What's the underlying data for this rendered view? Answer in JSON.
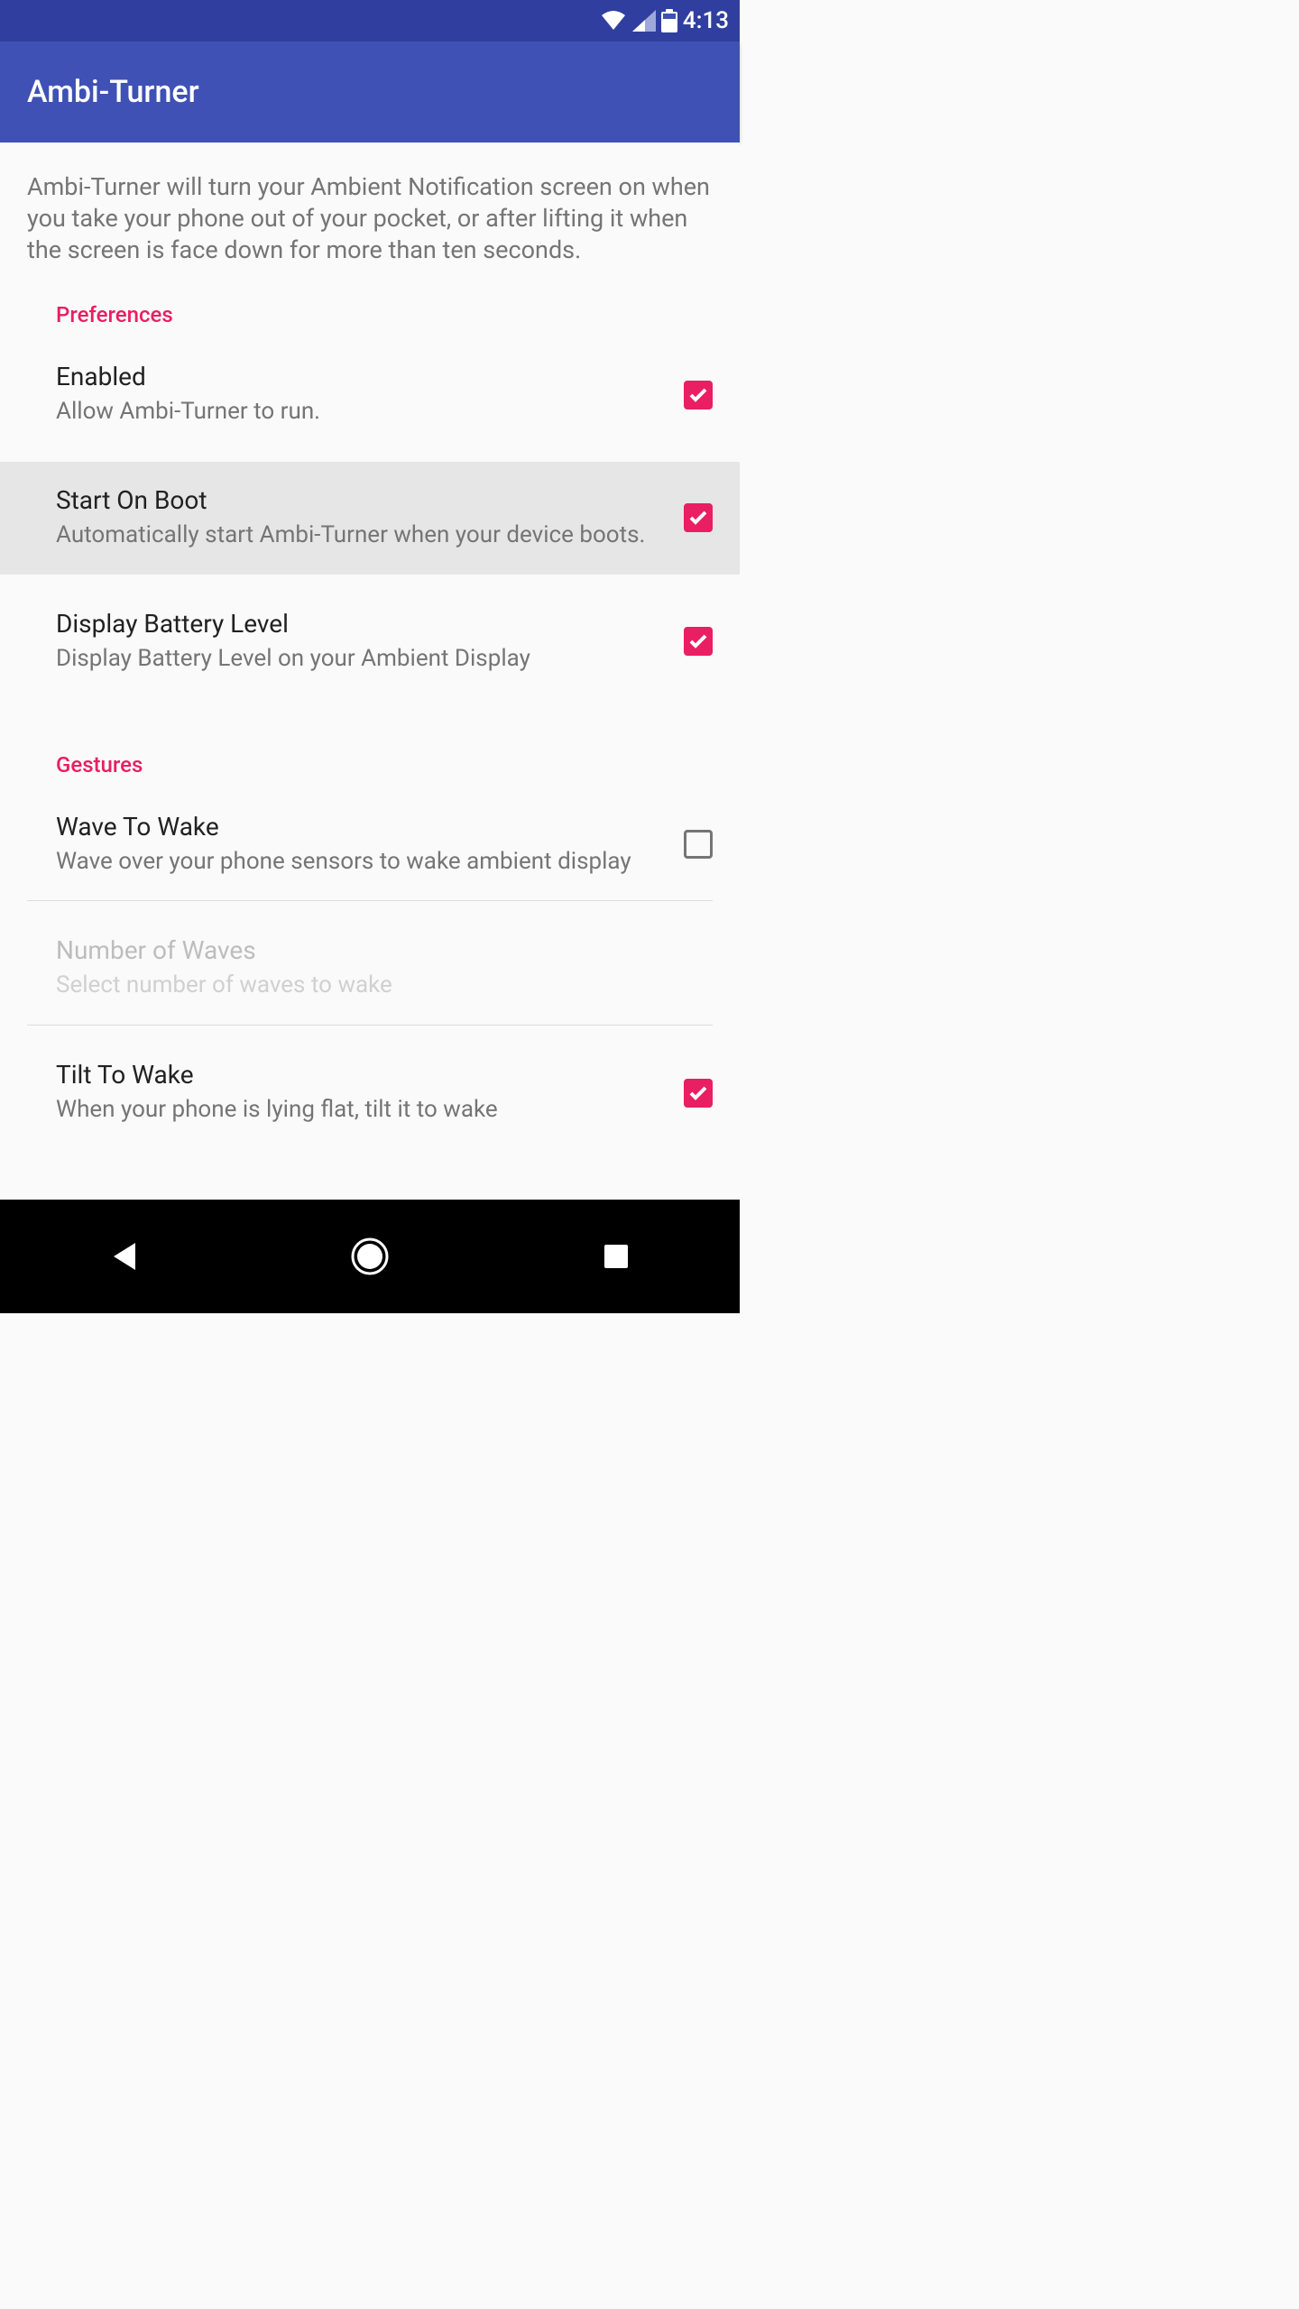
{
  "status": {
    "time": "4:13"
  },
  "app": {
    "title": "Ambi-Turner"
  },
  "intro": "Ambi-Turner will turn your Ambient Notification screen on when you take your phone out of your pocket, or after lifting it when the screen is face down for more than ten seconds.",
  "sections": {
    "preferences": {
      "header": "Preferences",
      "items": [
        {
          "title": "Enabled",
          "sub": "Allow Ambi-Turner to run.",
          "checked": true
        },
        {
          "title": "Start On Boot",
          "sub": "Automatically start Ambi-Turner when your device boots.",
          "checked": true,
          "selected": true
        },
        {
          "title": "Display Battery Level",
          "sub": "Display Battery Level on your Ambient Display",
          "checked": true
        }
      ]
    },
    "gestures": {
      "header": "Gestures",
      "items": [
        {
          "title": "Wave To Wake",
          "sub": "Wave over your phone sensors to wake ambient display",
          "checked": false
        },
        {
          "title": "Number of Waves",
          "sub": "Select number of waves to wake",
          "disabled": true
        },
        {
          "title": "Tilt To Wake",
          "sub": "When your phone is lying flat, tilt it to wake",
          "checked": true
        }
      ]
    }
  }
}
